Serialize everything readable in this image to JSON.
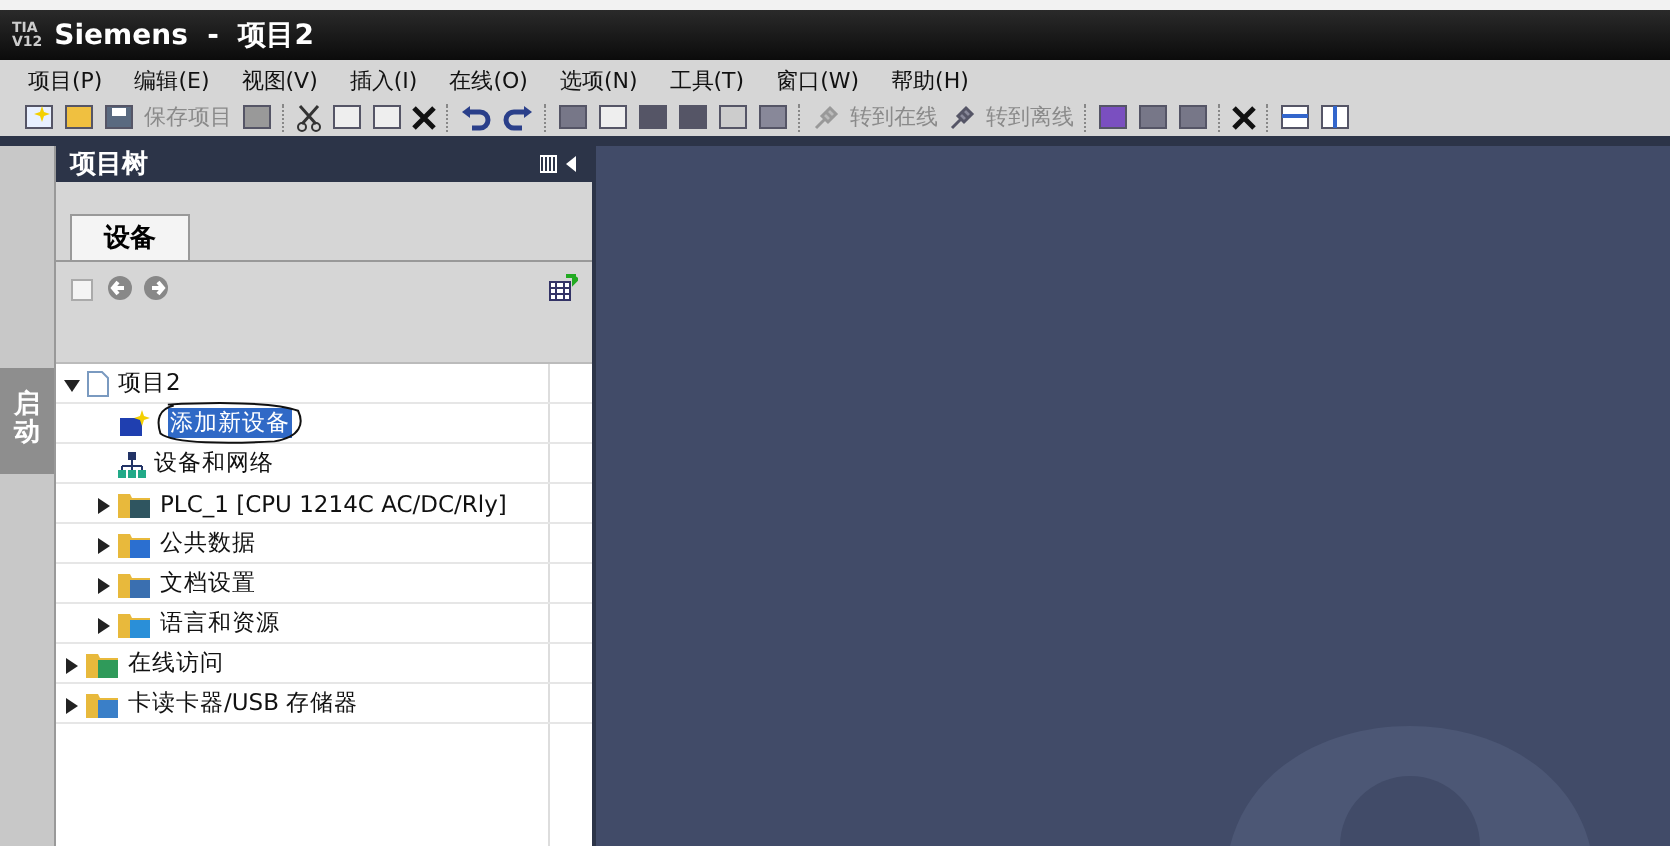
{
  "window": {
    "logo": "TIA\nV12",
    "title": "Siemens  -  项目2"
  },
  "menu": [
    "项目(P)",
    "编辑(E)",
    "视图(V)",
    "插入(I)",
    "在线(O)",
    "选项(N)",
    "工具(T)",
    "窗口(W)",
    "帮助(H)"
  ],
  "toolbar": [
    {
      "label": "保存项目",
      "disabled": true
    },
    {
      "label": "转到在线",
      "disabled": true
    },
    {
      "label": "转到离线",
      "disabled": true
    }
  ],
  "side_tab": {
    "label": "启动"
  },
  "project_tree": {
    "title": "项目树",
    "tabs": [
      {
        "label": "设备",
        "selected": true
      }
    ],
    "items": [
      {
        "label": "项目2",
        "kind": "project",
        "expanded": true,
        "selected": false,
        "children": [
          {
            "label": "添加新设备",
            "kind": "add",
            "selected": true,
            "annotated": true
          },
          {
            "label": "设备和网络",
            "kind": "network",
            "selected": false
          },
          {
            "label": "PLC_1 [CPU 1214C AC/DC/Rly]",
            "kind": "plc",
            "expanded": false,
            "selected": false
          },
          {
            "label": "公共数据",
            "kind": "data",
            "expanded": false,
            "selected": false
          },
          {
            "label": "文档设置",
            "kind": "docs",
            "expanded": false,
            "selected": false
          },
          {
            "label": "语言和资源",
            "kind": "lang",
            "expanded": false,
            "selected": false
          }
        ]
      },
      {
        "label": "在线访问",
        "kind": "online",
        "expanded": false,
        "selected": false
      },
      {
        "label": "卡读卡器/USB 存储器",
        "kind": "card",
        "expanded": false,
        "selected": false
      }
    ]
  }
}
